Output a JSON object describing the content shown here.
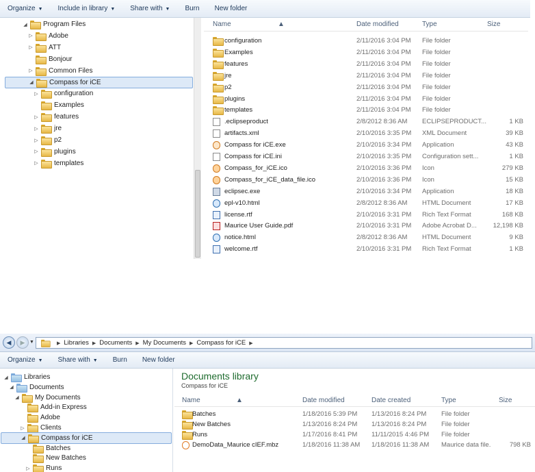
{
  "top": {
    "toolbar": [
      {
        "label": "Organize",
        "dropdown": true
      },
      {
        "label": "Include in library",
        "dropdown": true
      },
      {
        "label": "Share with",
        "dropdown": true
      },
      {
        "label": "Burn",
        "dropdown": false
      },
      {
        "label": "New folder",
        "dropdown": false
      }
    ],
    "tree": [
      {
        "label": "Program Files",
        "arrow": "expanded",
        "indent": 0
      },
      {
        "label": "Adobe",
        "arrow": "collapsed",
        "indent": 1
      },
      {
        "label": "ATT",
        "arrow": "collapsed",
        "indent": 1
      },
      {
        "label": "Bonjour",
        "arrow": "none",
        "indent": 1
      },
      {
        "label": "Common Files",
        "arrow": "collapsed",
        "indent": 1
      },
      {
        "label": "Compass for iCE",
        "arrow": "expanded",
        "indent": 1,
        "selected": true
      },
      {
        "label": "configuration",
        "arrow": "collapsed",
        "indent": 2
      },
      {
        "label": "Examples",
        "arrow": "none",
        "indent": 2
      },
      {
        "label": "features",
        "arrow": "collapsed",
        "indent": 2
      },
      {
        "label": "jre",
        "arrow": "collapsed",
        "indent": 2
      },
      {
        "label": "p2",
        "arrow": "collapsed",
        "indent": 2
      },
      {
        "label": "plugins",
        "arrow": "collapsed",
        "indent": 2
      },
      {
        "label": "templates",
        "arrow": "collapsed",
        "indent": 2
      }
    ],
    "columns": {
      "name": "Name",
      "date": "Date modified",
      "type": "Type",
      "size": "Size"
    },
    "files": [
      {
        "name": "configuration",
        "date": "2/11/2016 3:04 PM",
        "type": "File folder",
        "size": "",
        "icon": "folder-icon"
      },
      {
        "name": "Examples",
        "date": "2/11/2016 3:04 PM",
        "type": "File folder",
        "size": "",
        "icon": "folder-icon"
      },
      {
        "name": "features",
        "date": "2/11/2016 3:04 PM",
        "type": "File folder",
        "size": "",
        "icon": "folder-icon"
      },
      {
        "name": "jre",
        "date": "2/11/2016 3:04 PM",
        "type": "File folder",
        "size": "",
        "icon": "folder-icon"
      },
      {
        "name": "p2",
        "date": "2/11/2016 3:04 PM",
        "type": "File folder",
        "size": "",
        "icon": "folder-icon"
      },
      {
        "name": "plugins",
        "date": "2/11/2016 3:04 PM",
        "type": "File folder",
        "size": "",
        "icon": "folder-icon"
      },
      {
        "name": "templates",
        "date": "2/11/2016 3:04 PM",
        "type": "File folder",
        "size": "",
        "icon": "folder-icon"
      },
      {
        "name": ".eclipseproduct",
        "date": "2/8/2012 8:36 AM",
        "type": "ECLIPSEPRODUCT...",
        "size": "1 KB",
        "icon": "file-icon"
      },
      {
        "name": "artifacts.xml",
        "date": "2/10/2016 3:35 PM",
        "type": "XML Document",
        "size": "39 KB",
        "icon": "file-icon"
      },
      {
        "name": "Compass for iCE.exe",
        "date": "2/10/2016 3:34 PM",
        "type": "Application",
        "size": "43 KB",
        "icon": "exe-icon"
      },
      {
        "name": "Compass for iCE.ini",
        "date": "2/10/2016 3:35 PM",
        "type": "Configuration sett...",
        "size": "1 KB",
        "icon": "ini-icon"
      },
      {
        "name": "Compass_for_iCE.ico",
        "date": "2/10/2016 3:36 PM",
        "type": "Icon",
        "size": "279 KB",
        "icon": "ico-icon"
      },
      {
        "name": "Compass_for_iCE_data_file.ico",
        "date": "2/10/2016 3:36 PM",
        "type": "Icon",
        "size": "15 KB",
        "icon": "ico-icon"
      },
      {
        "name": "eclipsec.exe",
        "date": "2/10/2016 3:34 PM",
        "type": "Application",
        "size": "18 KB",
        "icon": "app-icon"
      },
      {
        "name": "epl-v10.html",
        "date": "2/8/2012 8:36 AM",
        "type": "HTML Document",
        "size": "17 KB",
        "icon": "html-icon"
      },
      {
        "name": "license.rtf",
        "date": "2/10/2016 3:31 PM",
        "type": "Rich Text Format",
        "size": "168 KB",
        "icon": "rtf-icon"
      },
      {
        "name": "Maurice User Guide.pdf",
        "date": "2/10/2016 3:31 PM",
        "type": "Adobe Acrobat D...",
        "size": "12,198 KB",
        "icon": "pdf-icon"
      },
      {
        "name": "notice.html",
        "date": "2/8/2012 8:36 AM",
        "type": "HTML Document",
        "size": "9 KB",
        "icon": "html-icon"
      },
      {
        "name": "welcome.rtf",
        "date": "2/10/2016 3:31 PM",
        "type": "Rich Text Format",
        "size": "1 KB",
        "icon": "rtf-icon"
      }
    ]
  },
  "bottom": {
    "breadcrumbs": [
      "Libraries",
      "Documents",
      "My Documents",
      "Compass for iCE"
    ],
    "toolbar": [
      {
        "label": "Organize",
        "dropdown": true
      },
      {
        "label": "Share with",
        "dropdown": true
      },
      {
        "label": "Burn",
        "dropdown": false
      },
      {
        "label": "New folder",
        "dropdown": false
      }
    ],
    "tree": [
      {
        "label": "Libraries",
        "arrow": "expanded",
        "indent": 0,
        "icon": "library-icon"
      },
      {
        "label": "Documents",
        "arrow": "expanded",
        "indent": 1,
        "icon": "library-icon"
      },
      {
        "label": "My Documents",
        "arrow": "expanded",
        "indent": 2
      },
      {
        "label": "Add-in Express",
        "arrow": "none",
        "indent": 3
      },
      {
        "label": "Adobe",
        "arrow": "none",
        "indent": 3
      },
      {
        "label": "Clients",
        "arrow": "collapsed",
        "indent": 3
      },
      {
        "label": "Compass for iCE",
        "arrow": "expanded",
        "indent": 3,
        "selected": true
      },
      {
        "label": "Batches",
        "arrow": "none",
        "indent": 4
      },
      {
        "label": "New Batches",
        "arrow": "none",
        "indent": 4
      },
      {
        "label": "Runs",
        "arrow": "collapsed",
        "indent": 4
      }
    ],
    "library_title": "Documents library",
    "library_subtitle": "Compass for iCE",
    "columns": {
      "name": "Name",
      "modified": "Date modified",
      "created": "Date created",
      "type": "Type",
      "size": "Size"
    },
    "files": [
      {
        "name": "Batches",
        "modified": "1/18/2016 5:39 PM",
        "created": "1/13/2016 8:24 PM",
        "type": "File folder",
        "size": "",
        "icon": "folder-icon"
      },
      {
        "name": "New Batches",
        "modified": "1/13/2016 8:24 PM",
        "created": "1/13/2016 8:24 PM",
        "type": "File folder",
        "size": "",
        "icon": "folder-icon"
      },
      {
        "name": "Runs",
        "modified": "1/17/2016 8:41 PM",
        "created": "11/11/2015 4:46 PM",
        "type": "File folder",
        "size": "",
        "icon": "folder-icon"
      },
      {
        "name": "DemoData_Maurice cIEF.mbz",
        "modified": "1/18/2016 11:38 AM",
        "created": "1/18/2016 11:38 AM",
        "type": "Maurice data file.",
        "size": "798 KB",
        "icon": "mbz-icon"
      }
    ]
  }
}
